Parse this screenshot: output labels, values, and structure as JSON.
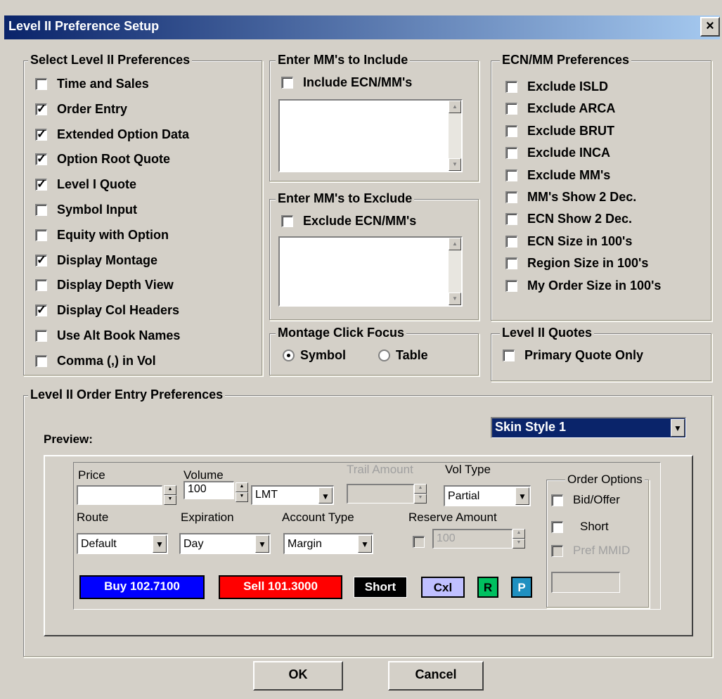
{
  "window": {
    "title": "Level II Preference Setup",
    "close_label": "×"
  },
  "select_prefs": {
    "legend": "Select Level II Preferences",
    "items": [
      {
        "label": "Time and Sales",
        "checked": false
      },
      {
        "label": "Order Entry",
        "checked": true
      },
      {
        "label": "Extended Option Data",
        "checked": true
      },
      {
        "label": "Option Root Quote",
        "checked": true
      },
      {
        "label": "Level I Quote",
        "checked": true
      },
      {
        "label": "Symbol Input",
        "checked": false
      },
      {
        "label": "Equity with Option",
        "checked": false
      },
      {
        "label": "Display Montage",
        "checked": true
      },
      {
        "label": "Display Depth View",
        "checked": false
      },
      {
        "label": "Display Col Headers",
        "checked": true
      },
      {
        "label": "Use Alt Book Names",
        "checked": false
      },
      {
        "label": "Comma (,) in Vol",
        "checked": false
      }
    ]
  },
  "include_mm": {
    "legend": "Enter MM's to Include",
    "checkbox_label": "Include ECN/MM's"
  },
  "exclude_mm": {
    "legend": "Enter MM's to Exclude",
    "checkbox_label": "Exclude ECN/MM's"
  },
  "ecn_prefs": {
    "legend": "ECN/MM Preferences",
    "items": [
      {
        "label": "Exclude ISLD",
        "checked": false
      },
      {
        "label": "Exclude ARCA",
        "checked": false
      },
      {
        "label": "Exclude BRUT",
        "checked": false
      },
      {
        "label": "Exclude INCA",
        "checked": false
      },
      {
        "label": "Exclude MM's",
        "checked": false
      },
      {
        "label": "MM's Show 2 Dec.",
        "checked": false
      },
      {
        "label": "ECN Show 2 Dec.",
        "checked": false
      },
      {
        "label": "ECN Size in 100's",
        "checked": false
      },
      {
        "label": "Region Size in 100's",
        "checked": false
      },
      {
        "label": "My Order Size in 100's",
        "checked": false
      }
    ]
  },
  "montage_focus": {
    "legend": "Montage Click Focus",
    "opt_symbol": "Symbol",
    "opt_table": "Table",
    "selected": "Symbol"
  },
  "level2_quotes": {
    "legend": "Level II Quotes",
    "checkbox_label": "Primary Quote Only"
  },
  "order_entry": {
    "legend": "Level II Order Entry Preferences",
    "preview_label": "Preview:",
    "skin_value": "Skin Style 1",
    "price_label": "Price",
    "price_value": "",
    "volume_label": "Volume",
    "volume_value": "100",
    "order_type": "LMT",
    "trail_label": "Trail Amount",
    "trail_value": "",
    "vol_type_label": "Vol Type",
    "vol_type_value": "Partial",
    "order_options_legend": "Order Options",
    "bid_offer_label": "Bid/Offer",
    "short_label": "Short",
    "pref_mmid_label": "Pref MMID",
    "route_label": "Route",
    "route_value": "Default",
    "expiration_label": "Expiration",
    "expiration_value": "Day",
    "account_type_label": "Account Type",
    "account_type_value": "Margin",
    "reserve_label": "Reserve Amount",
    "reserve_value": "100",
    "buy_label": "Buy 102.7100",
    "sell_label": "Sell 101.3000",
    "short_btn_label": "Short",
    "cxl_label": "Cxl",
    "r_label": "R",
    "p_label": "P"
  },
  "buttons": {
    "ok": "OK",
    "cancel": "Cancel"
  },
  "colors": {
    "buy": "#0000ff",
    "sell": "#ff0000",
    "short": "#000000",
    "cxl": "#c0c0ff",
    "r": "#00c060",
    "p": "#2090c0",
    "title_start": "#0a246a"
  }
}
